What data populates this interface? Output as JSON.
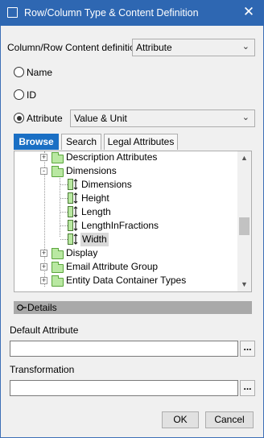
{
  "window": {
    "title": "Row/Column Type & Content Definition",
    "close_glyph": "✕"
  },
  "content_definition": {
    "label": "Column/Row Content definition",
    "value": "Attribute"
  },
  "radios": [
    {
      "label": "Name",
      "selected": false
    },
    {
      "label": "ID",
      "selected": false
    },
    {
      "label": "Attribute",
      "selected": true
    }
  ],
  "attribute_combo": {
    "value": "Value & Unit"
  },
  "tabs": [
    {
      "label": "Browse",
      "active": true
    },
    {
      "label": "Search",
      "active": false
    },
    {
      "label": "Legal Attributes",
      "active": false
    }
  ],
  "tree": {
    "items": [
      {
        "label": "Description Attributes",
        "kind": "folder",
        "expander": "+"
      },
      {
        "label": "Dimensions",
        "kind": "folder",
        "expander": "-"
      },
      {
        "label": "Dimensions",
        "kind": "attribute"
      },
      {
        "label": "Height",
        "kind": "attribute"
      },
      {
        "label": "Length",
        "kind": "attribute"
      },
      {
        "label": "LengthInFractions",
        "kind": "attribute"
      },
      {
        "label": "Width",
        "kind": "attribute",
        "selected": true
      },
      {
        "label": "Display",
        "kind": "folder",
        "expander": "+"
      },
      {
        "label": "Email Attribute Group",
        "kind": "folder",
        "expander": "+"
      },
      {
        "label": "Entity Data Container Types",
        "kind": "folder",
        "expander": "+"
      }
    ],
    "scroll_position": 0.55
  },
  "details": {
    "label": "Details"
  },
  "default_attribute": {
    "label": "Default Attribute",
    "value": "",
    "browse_label": "..."
  },
  "transformation": {
    "label": "Transformation",
    "value": "",
    "browse_label": "..."
  },
  "buttons": {
    "ok": "OK",
    "cancel": "Cancel"
  },
  "colors": {
    "title_bar": "#2e67b2",
    "active_tab": "#1a6fc4",
    "folder": "#b9e8a2",
    "selection": "#d9d9d9"
  },
  "icons": {
    "window": "window-icon",
    "close": "close-icon",
    "folder": "folder-icon",
    "attribute": "attribute-icon",
    "expand": "expand-icon",
    "collapse": "collapse-icon"
  }
}
